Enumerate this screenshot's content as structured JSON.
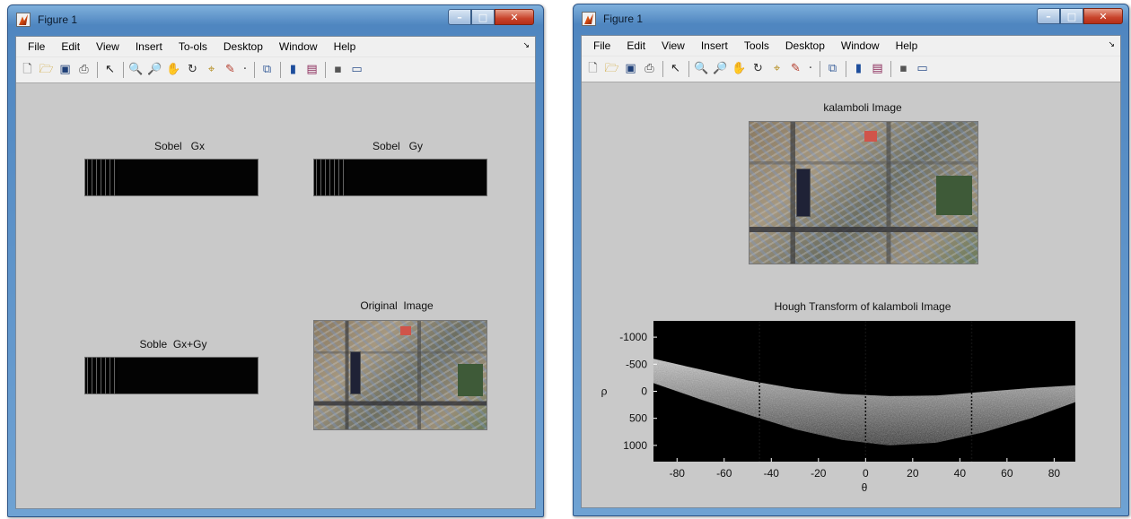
{
  "windows": [
    {
      "title": "Figure 1",
      "menu": [
        "File",
        "Edit",
        "View",
        "Insert",
        "To-ols",
        "Desktop",
        "Window",
        "Help"
      ],
      "menu_arrow": "↘",
      "axes": {
        "sobel_gx": "Sobel   Gx",
        "sobel_gy": "Sobel   Gy",
        "soble_gxgy": "Soble  Gx+Gy",
        "original": "Original  Image"
      }
    },
    {
      "title": "Figure 1",
      "menu": [
        "File",
        "Edit",
        "View",
        "Insert",
        "Tools",
        "Desktop",
        "Window",
        "Help"
      ],
      "menu_arrow": "↘",
      "axes": {
        "kalamboli": "kalamboli Image",
        "hough": "Hough Transform of kalamboli Image",
        "hough_xlabel": "θ",
        "hough_ylabel": "ρ"
      }
    }
  ],
  "toolbar_icons": [
    "new-file-icon",
    "open-folder-icon",
    "save-icon",
    "print-icon",
    "pointer-icon",
    "zoom-in-icon",
    "zoom-out-icon",
    "pan-hand-icon",
    "rotate-3d-icon",
    "data-cursor-icon",
    "brush-icon",
    "insert-colorbar-icon",
    "insert-legend-icon",
    "hide-plot-tools-icon",
    "show-plot-tools-icon"
  ],
  "chart_data": {
    "type": "heatmap",
    "title": "Hough Transform of kalamboli Image",
    "xlabel": "θ",
    "ylabel": "ρ",
    "xlim": [
      -90,
      89
    ],
    "ylim": [
      -1300,
      1300
    ],
    "y_reversed": true,
    "x_ticks": [
      -80,
      -60,
      -40,
      -20,
      0,
      20,
      40,
      60,
      80
    ],
    "y_ticks": [
      -1000,
      -500,
      0,
      500,
      1000
    ],
    "colormap": "gray",
    "band_upper_rho": [
      -600,
      -400,
      -200,
      -50,
      50,
      90,
      80,
      10,
      -60,
      -110
    ],
    "band_lower_rho": [
      -150,
      150,
      430,
      700,
      900,
      1000,
      950,
      760,
      500,
      200
    ],
    "band_theta": [
      -90,
      -70,
      -50,
      -30,
      -10,
      10,
      30,
      50,
      70,
      89
    ]
  }
}
